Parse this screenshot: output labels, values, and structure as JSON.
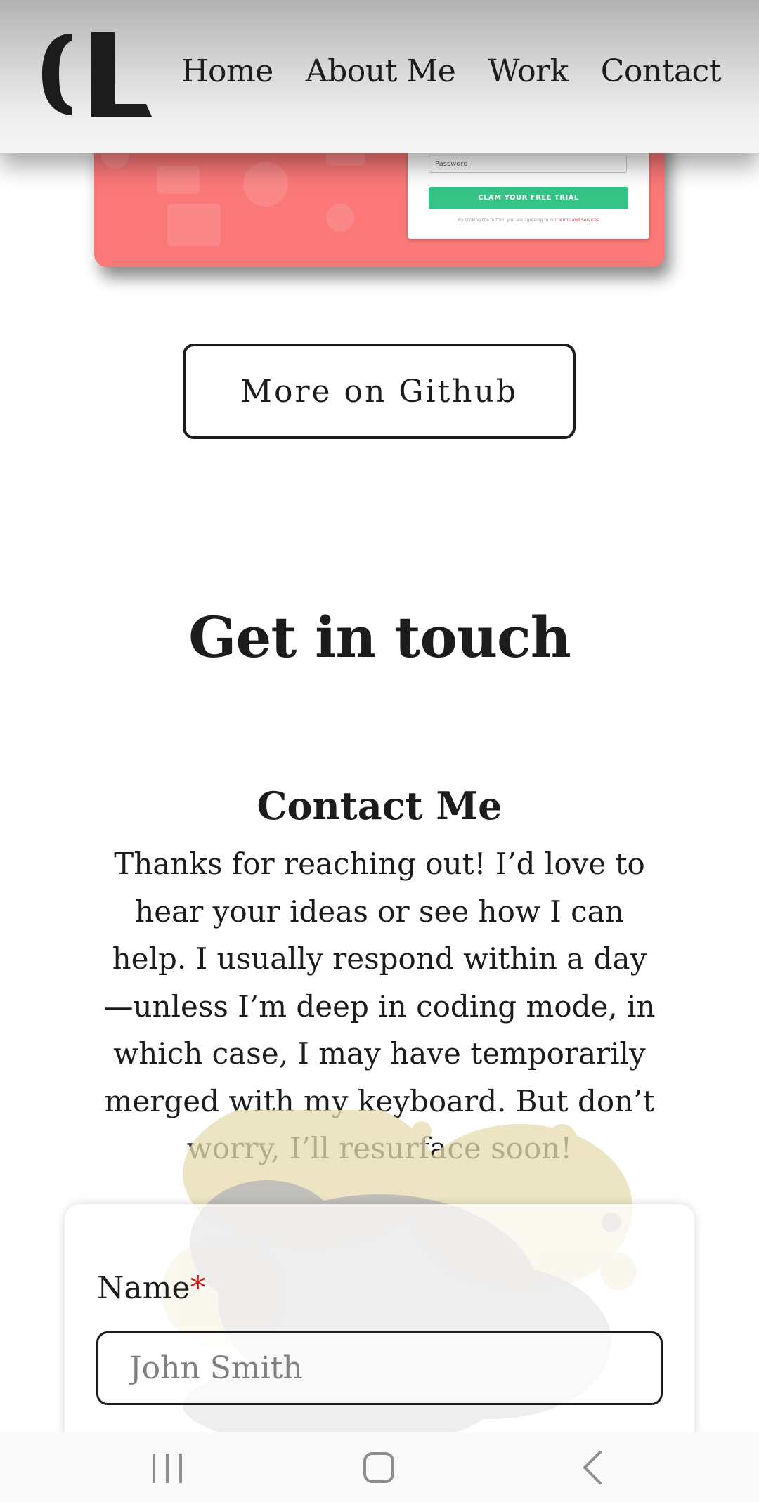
{
  "header": {
    "logo_text": "CL",
    "nav": [
      {
        "label": "Home"
      },
      {
        "label": "About Me"
      },
      {
        "label": "Work"
      },
      {
        "label": "Contact"
      }
    ]
  },
  "preview": {
    "password_placeholder": "Password",
    "trial_button": "CLAM YOUR FREE TRIAL",
    "terms_prefix": "By clicking the button, you are agreeing to our ",
    "terms_link": "Terms and Services",
    "background_color": "#fb7878",
    "button_color": "#35c486"
  },
  "github_button": "More on Github",
  "contact": {
    "section_title": "Get in touch",
    "heading": "Contact Me",
    "text": "Thanks for reaching out! I’d love to hear your ideas or see how I can help. I usually respond within a day—unless I’m deep in coding mode, in which case, I may have temporarily merged with my keyboard. But don’t worry, I’ll resurface soon!",
    "form": {
      "name_label": "Name",
      "required_mark": "*",
      "name_placeholder": "John Smith"
    }
  },
  "system_nav": {
    "recents": "recents-icon",
    "home": "home-icon",
    "back": "back-icon"
  }
}
